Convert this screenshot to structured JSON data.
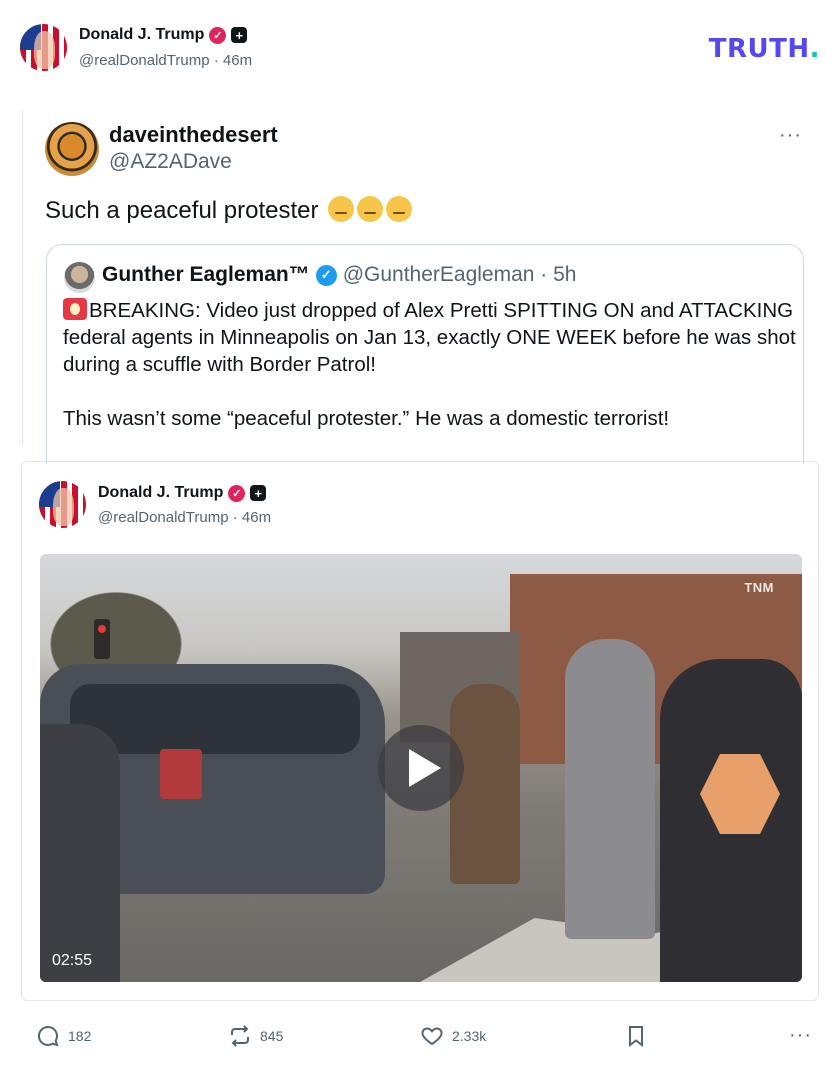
{
  "header": {
    "name": "Donald J. Trump",
    "handle": "@realDonaldTrump",
    "time": "46m",
    "logo": "TRUTH",
    "logo_dot": "."
  },
  "quoted_post": {
    "author": "daveinthedesert",
    "handle": "@AZ2ADave",
    "text": "Such a peaceful protester",
    "more": "···",
    "quote": {
      "author": "Gunther Eagleman™",
      "meta": "@GuntherEagleman · 5h",
      "paragraph1": "BREAKING: Video just dropped of Alex Pretti SPITTING ON and ATTACKING federal agents in Minneapolis on Jan 13, exactly ONE WEEK before he was shot during a scuffle with Border Patrol!",
      "paragraph2": "This wasn’t some “peaceful protester.” He was a domestic terrorist!"
    }
  },
  "post": {
    "name": "Donald J. Trump",
    "handle": "@realDonaldTrump",
    "time": "46m",
    "video": {
      "duration": "02:55",
      "watermark": "TNM"
    }
  },
  "actions": {
    "replies": "182",
    "retruths": "845",
    "likes": "2.33k",
    "more": "···"
  },
  "colors": {
    "brand": "#5448ee",
    "verified": "#e0245e",
    "quote_verified": "#1d9bf0",
    "muted": "#536471"
  }
}
